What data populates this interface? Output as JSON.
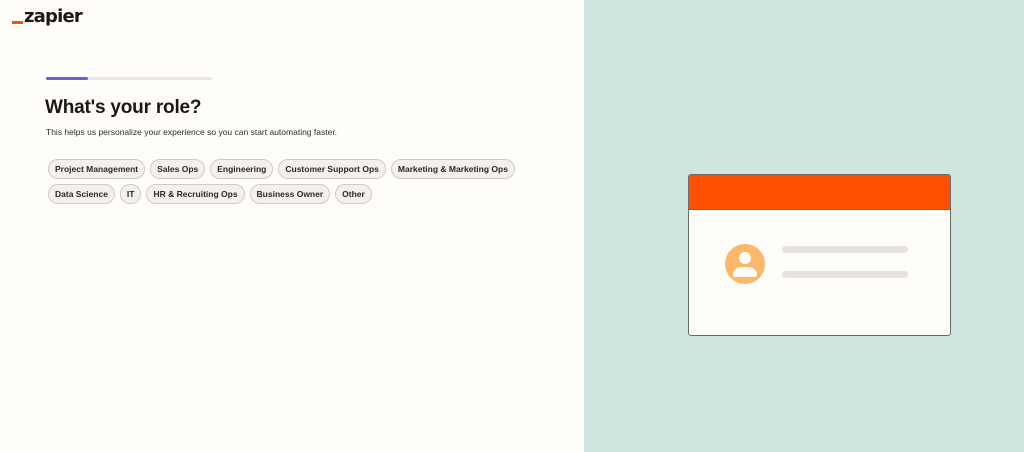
{
  "logo": {
    "text": "zapier"
  },
  "progress": {
    "fraction": 0.25
  },
  "title": "What's your role?",
  "subtitle": "This helps us personalize your experience so you can start automating faster.",
  "roles": [
    "Project Management",
    "Sales Ops",
    "Engineering",
    "Customer Support Ops",
    "Marketing & Marketing Ops",
    "Data Science",
    "IT",
    "HR & Recruiting Ops",
    "Business Owner",
    "Other"
  ],
  "colors": {
    "brand": "#ff4f00",
    "progress_accent": "#6a5fd4",
    "right_panel": "#cfe5e0",
    "avatar": "#fbb86b"
  },
  "illustration": {
    "icon": "user-avatar-icon"
  }
}
